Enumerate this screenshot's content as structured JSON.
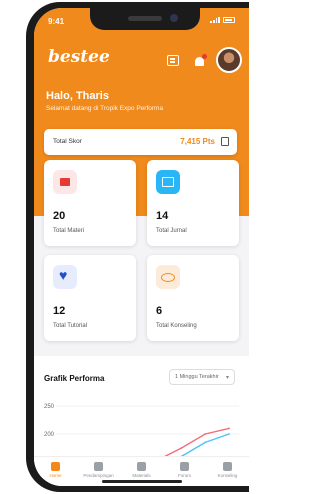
{
  "status_bar": {
    "time": "9:41"
  },
  "header": {
    "brand": "bestee",
    "icons": [
      "document-icon",
      "bell-icon",
      "avatar"
    ],
    "greeting": "Halo, Tharis",
    "subtitle": "Selamat datang di Tropik Expo Performa"
  },
  "points": {
    "label": "Total Skor",
    "value": "7,415 Pts"
  },
  "stats": [
    {
      "value": "20",
      "label": "Total Materi",
      "icon": "book-icon",
      "color": "#e53935"
    },
    {
      "value": "14",
      "label": "Total Jurnal",
      "icon": "screen-icon",
      "color": "#29b6f6"
    },
    {
      "value": "12",
      "label": "Total Tutorial",
      "icon": "heart-icon",
      "color": "#1f4fd1"
    },
    {
      "value": "6",
      "label": "Total Konseling",
      "icon": "eye-icon",
      "color": "#f08a1c"
    }
  ],
  "performance": {
    "title": "Grafik Performa",
    "filter": "1 Minggu Terakhir",
    "y_ticks": [
      "250",
      "200"
    ]
  },
  "chart_data": {
    "type": "line",
    "title": "Grafik Performa",
    "y_ticks": [
      250,
      200
    ],
    "series": [
      {
        "values": [
          140,
          150,
          175,
          200,
          210
        ],
        "color": "#f26d7d"
      },
      {
        "values": [
          120,
          135,
          160,
          185,
          200
        ],
        "color": "#4fc3f7"
      }
    ]
  },
  "tabbar": {
    "items": [
      {
        "label": "Home",
        "icon": "home-icon",
        "active": true
      },
      {
        "label": "Pendampingan",
        "icon": "people-icon",
        "active": false
      },
      {
        "label": "Materials",
        "icon": "book-icon",
        "active": false
      },
      {
        "label": "Forum",
        "icon": "forum-icon",
        "active": false
      },
      {
        "label": "Konseling",
        "icon": "chat-icon",
        "active": false
      }
    ]
  },
  "colors": {
    "accent": "#f08a1c",
    "background": "#f4f4f6"
  }
}
